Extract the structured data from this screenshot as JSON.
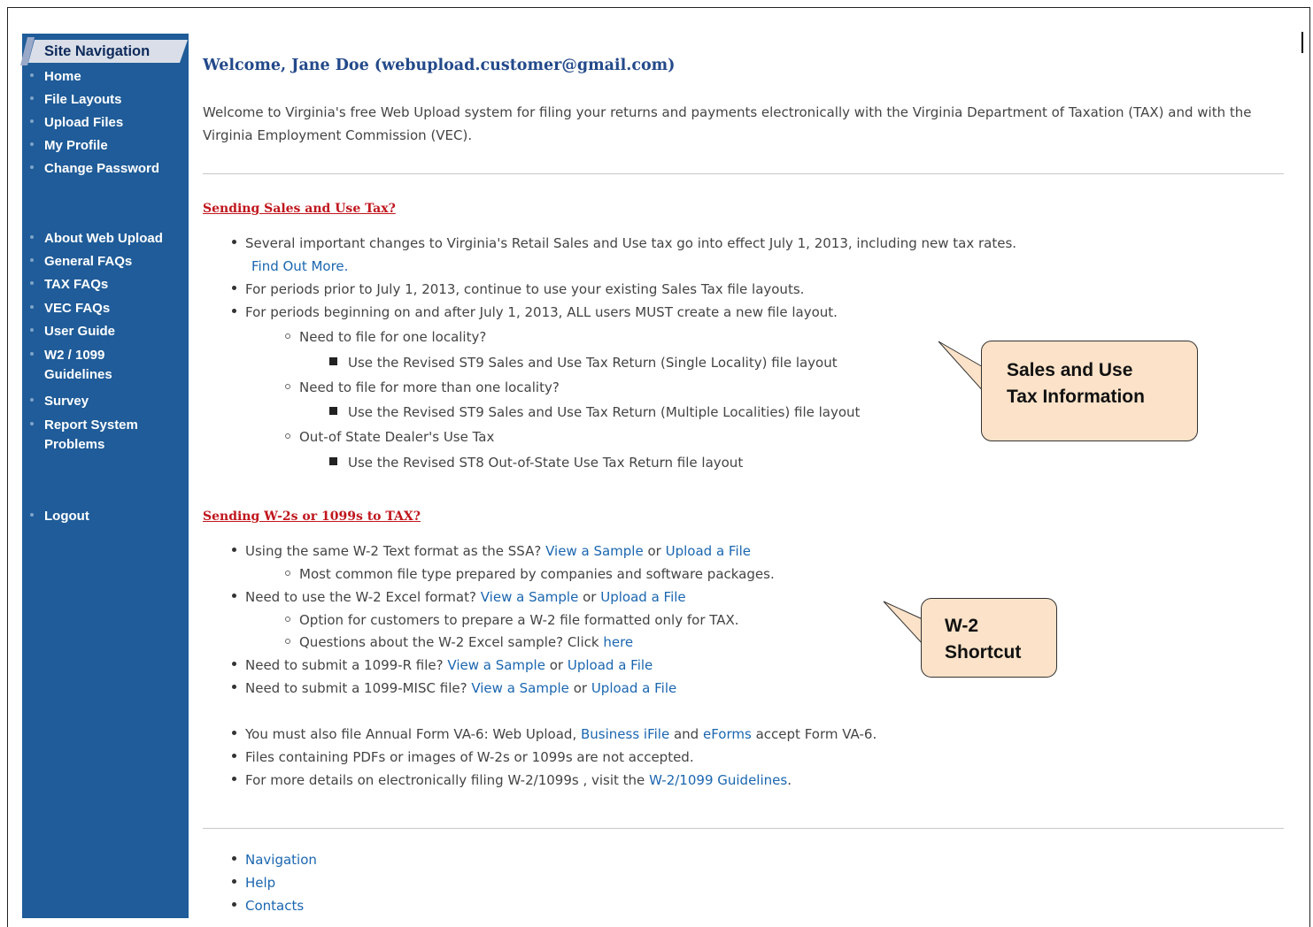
{
  "sidebar": {
    "title": "Site Navigation",
    "items": [
      {
        "label": "Home"
      },
      {
        "label": "File Layouts"
      },
      {
        "label": "Upload Files"
      },
      {
        "label": "My Profile"
      },
      {
        "label": "Change Password"
      },
      {
        "label": "About Web Upload"
      },
      {
        "label": "General FAQs"
      },
      {
        "label": "TAX FAQs"
      },
      {
        "label": "VEC FAQs"
      },
      {
        "label": "User Guide"
      },
      {
        "label": "W2 / 1099",
        "label2": "Guidelines"
      },
      {
        "label": "Survey"
      },
      {
        "label": "Report System",
        "label2": "Problems"
      },
      {
        "label": "Logout"
      }
    ]
  },
  "main": {
    "welcome": "Welcome, Jane Doe (webupload.customer@gmail.com)",
    "intro": "Welcome to Virginia's free Web Upload system for filing your returns and payments electronically with the Virginia Department of Taxation (TAX) and with the Virginia Employment Commission (VEC).",
    "sales": {
      "heading": "Sending Sales and Use Tax?",
      "b1": "Several important changes to Virginia's Retail Sales and Use tax go into effect July 1, 2013, including new tax rates.",
      "b1_link": "Find Out More.",
      "b2": "For periods prior to July 1, 2013, continue to use your existing Sales Tax file layouts.",
      "b3": "For periods beginning on and after July 1, 2013, ALL users MUST create a new file layout.",
      "s1": "Need to file for one locality?",
      "s1a": "Use the Revised ST9 Sales and Use Tax Return (Single Locality) file layout",
      "s2": "Need to file for more than one locality?",
      "s2a": "Use the Revised ST9 Sales and Use Tax Return (Multiple Localities) file layout",
      "s3": "Out-of State Dealer's Use Tax",
      "s3a": "Use the Revised ST8 Out-of-State Use Tax Return file layout"
    },
    "w2": {
      "heading": "Sending W-2s or 1099s to TAX?",
      "b1": "Using the same W-2 Text format as the SSA?",
      "b1_sub": "Most common file type prepared by companies and software packages.",
      "b2": "Need to use the W-2 Excel format?",
      "b2_sub1": "Option for customers to prepare a W-2 file formatted only for TAX.",
      "b2_sub2": "Questions about the W-2 Excel sample? Click",
      "here": "here",
      "b3": "Need to submit a 1099-R file?",
      "b4": "Need to submit a 1099-MISC file?",
      "view_sample": "View a Sample",
      "or": "or",
      "upload_file": "Upload a File",
      "b5_pre": "You must also file Annual Form VA-6: Web Upload,",
      "b5_link1": "Business iFile",
      "b5_and": "and",
      "b5_link2": "eForms",
      "b5_post": "accept Form VA-6.",
      "b6": "Files containing PDFs or images of W-2s or 1099s are not accepted.",
      "b7_pre": "For more details on electronically filing W-2/1099s , visit the",
      "b7_link": "W-2/1099 Guidelines",
      "b7_post": "."
    },
    "footer_links": [
      "Navigation",
      "Help",
      "Contacts"
    ]
  },
  "callouts": {
    "sales": "Sales and Use Tax Information",
    "sales_l1": "Sales and Use",
    "sales_l2": "Tax Information",
    "w2_l1": "W-2",
    "w2_l2": "Shortcut",
    "fill": "#fbe2c8"
  },
  "colors": {
    "sidebar": "#1f5c99",
    "heading_red": "#c0161d",
    "link": "#1a66b0",
    "welcome": "#23498a"
  }
}
